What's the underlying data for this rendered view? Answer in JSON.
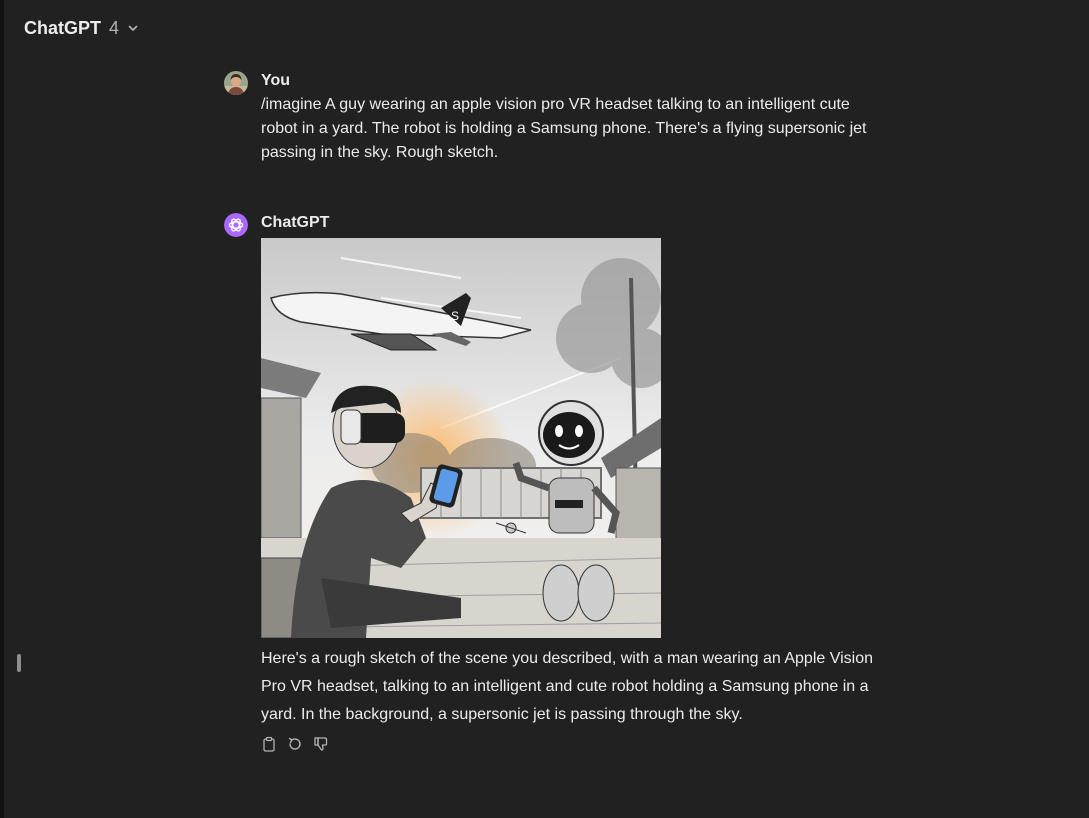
{
  "header": {
    "model_name": "ChatGPT",
    "model_version": "4",
    "dropdown_icon": "chevron-down-icon"
  },
  "messages": [
    {
      "role": "user",
      "author": "You",
      "text": "/imagine A guy wearing an apple vision pro VR headset talking to an intelligent cute robot in a yard. The robot is holding a Samsung phone. There's a flying supersonic jet passing in the sky. Rough sketch."
    },
    {
      "role": "assistant",
      "author": "ChatGPT",
      "image_description": "pencil sketch: man with VR headset sitting in a yard holding a phone, cute robot, supersonic jet in sky",
      "text": "Here's a rough sketch of the scene you described, with a man wearing an Apple Vision Pro VR headset, talking to an intelligent and cute robot holding a Samsung phone in a yard. In the background, a supersonic jet is passing through the sky.",
      "actions": [
        "clipboard-icon",
        "regenerate-icon",
        "thumbs-down-icon"
      ]
    }
  ],
  "colors": {
    "background": "#212121",
    "text": "#ececec",
    "assistant_avatar": "#ab68ff"
  }
}
